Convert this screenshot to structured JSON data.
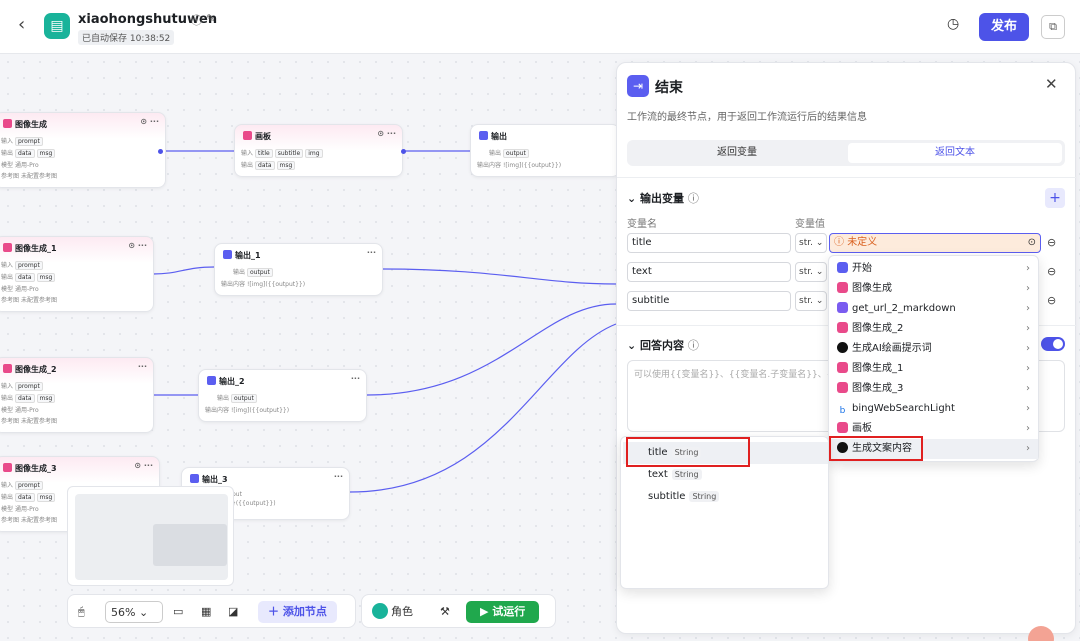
{
  "header": {
    "back_icon": "chevron-left-icon",
    "app_name": "xiaohongshutuwen",
    "autosave": "已自动保存 10:38:52",
    "publish": "发布"
  },
  "canvas": {
    "nodes": {
      "img": {
        "title": "图像生成",
        "in_label": "输入",
        "out_label": "输出",
        "model_label": "模型",
        "ref_label": "参考图",
        "in_chip": "prompt",
        "out_chip1": "data",
        "out_chip2": "msg",
        "model": "通用-Pro",
        "ref": "未配置参考图"
      },
      "img1": {
        "title": "图像生成_1"
      },
      "img2": {
        "title": "图像生成_2"
      },
      "img3": {
        "title": "图像生成_3"
      },
      "board": {
        "title": "画板",
        "in_label": "输入",
        "out_label": "输出",
        "in1": "title",
        "in2": "subtitle",
        "in3": "img",
        "out1": "data",
        "out2": "msg"
      },
      "out": {
        "title": "输出",
        "out_label": "输出",
        "content_label": "输出内容",
        "out_chip": "output",
        "content": "![img]({{output}})"
      },
      "out1": {
        "title": "输出_1"
      },
      "out2": {
        "title": "输出_2"
      },
      "out3": {
        "title": "输出_3",
        "out_chip": "put",
        "content": "}({{output}})"
      }
    }
  },
  "toolbar": {
    "zoom": "56%",
    "add_node": "添加节点",
    "role": "角色",
    "run": "试运行"
  },
  "panel": {
    "title": "结束",
    "description": "工作流的最终节点，用于返回工作流运行后的结果信息",
    "tabs": [
      "返回变量",
      "返回文本"
    ],
    "active_tab": "返回文本",
    "output_section": "输出变量",
    "col_name": "变量名",
    "col_value": "变量值",
    "variables": [
      {
        "name": "title",
        "type": "str.",
        "value": "未定义"
      },
      {
        "name": "text",
        "type": "str."
      },
      {
        "name": "subtitle",
        "type": "str."
      }
    ],
    "answer_section": "回答内容",
    "answer_placeholder": "可以使用{{变量名}}、{{变量名.子变量名}}、{{"
  },
  "dropdown": {
    "items": [
      {
        "label": "开始",
        "icon": "start-icon",
        "color": "#5b5ef0"
      },
      {
        "label": "图像生成",
        "icon": "image-gen-icon",
        "color": "#e94a8a"
      },
      {
        "label": "get_url_2_markdown",
        "icon": "plugin-icon",
        "color": "#7a5cf0"
      },
      {
        "label": "图像生成_2",
        "icon": "image-gen-icon",
        "color": "#e94a8a"
      },
      {
        "label": "生成AI绘画提示词",
        "icon": "llm-icon",
        "color": "#111111"
      },
      {
        "label": "图像生成_1",
        "icon": "image-gen-icon",
        "color": "#e94a8a"
      },
      {
        "label": "图像生成_3",
        "icon": "image-gen-icon",
        "color": "#e94a8a"
      },
      {
        "label": "bingWebSearchLight",
        "icon": "bing-icon",
        "color": "#1a73e8"
      },
      {
        "label": "画板",
        "icon": "board-icon",
        "color": "#e94a8a"
      },
      {
        "label": "生成文案内容",
        "icon": "llm-icon",
        "color": "#111111"
      }
    ],
    "highlighted": "生成文案内容"
  },
  "subdropdown": {
    "items": [
      {
        "name": "title",
        "type": "String"
      },
      {
        "name": "text",
        "type": "String"
      },
      {
        "name": "subtitle",
        "type": "String"
      }
    ],
    "highlighted": "title"
  }
}
